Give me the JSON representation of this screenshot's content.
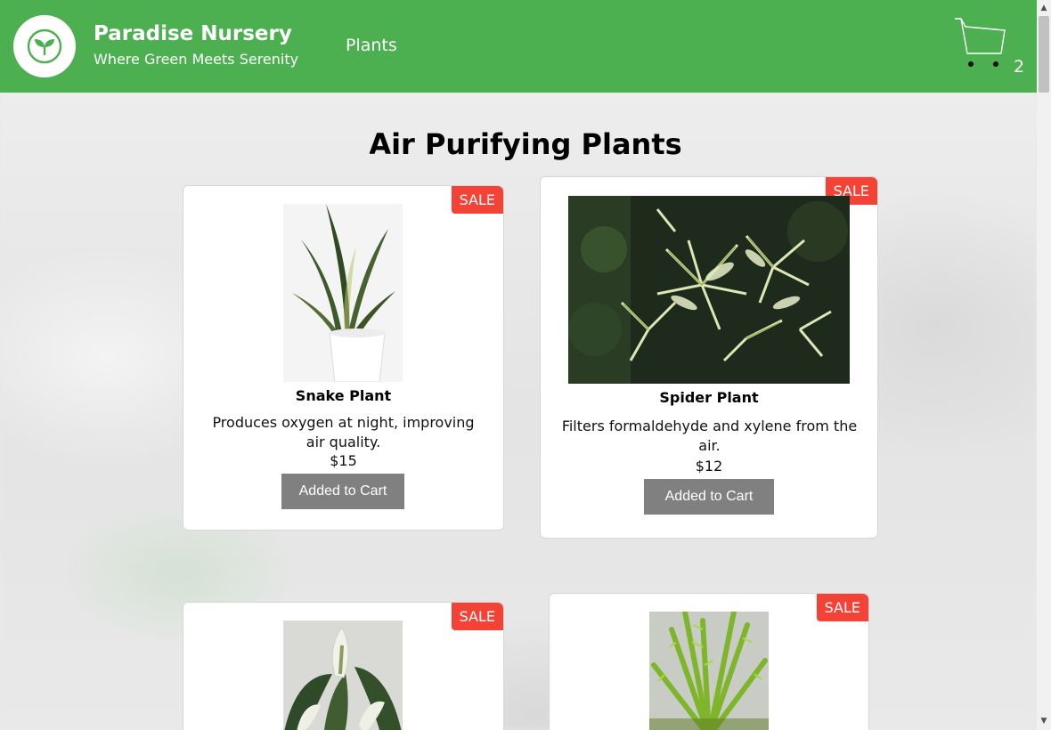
{
  "header": {
    "title": "Paradise Nursery",
    "tagline": "Where Green Meets Serenity",
    "nav_plants": "Plants",
    "cart_count": "2"
  },
  "section": {
    "title": "Air Purifying Plants"
  },
  "products": [
    {
      "name": "Snake Plant",
      "description": "Produces oxygen at night, improving air quality.",
      "price": "$15",
      "badge": "SALE",
      "button": "Added to Cart"
    },
    {
      "name": "Spider Plant",
      "description": "Filters formaldehyde and xylene from the air.",
      "price": "$12",
      "badge": "SALE",
      "button": "Added to Cart"
    },
    {
      "badge": "SALE"
    },
    {
      "badge": "SALE"
    }
  ],
  "colors": {
    "header_bg": "#4caf50",
    "sale_badge": "#f44336",
    "button_added": "#808080"
  },
  "icons": {
    "logo": "seedling-icon",
    "cart": "shopping-cart-icon"
  }
}
